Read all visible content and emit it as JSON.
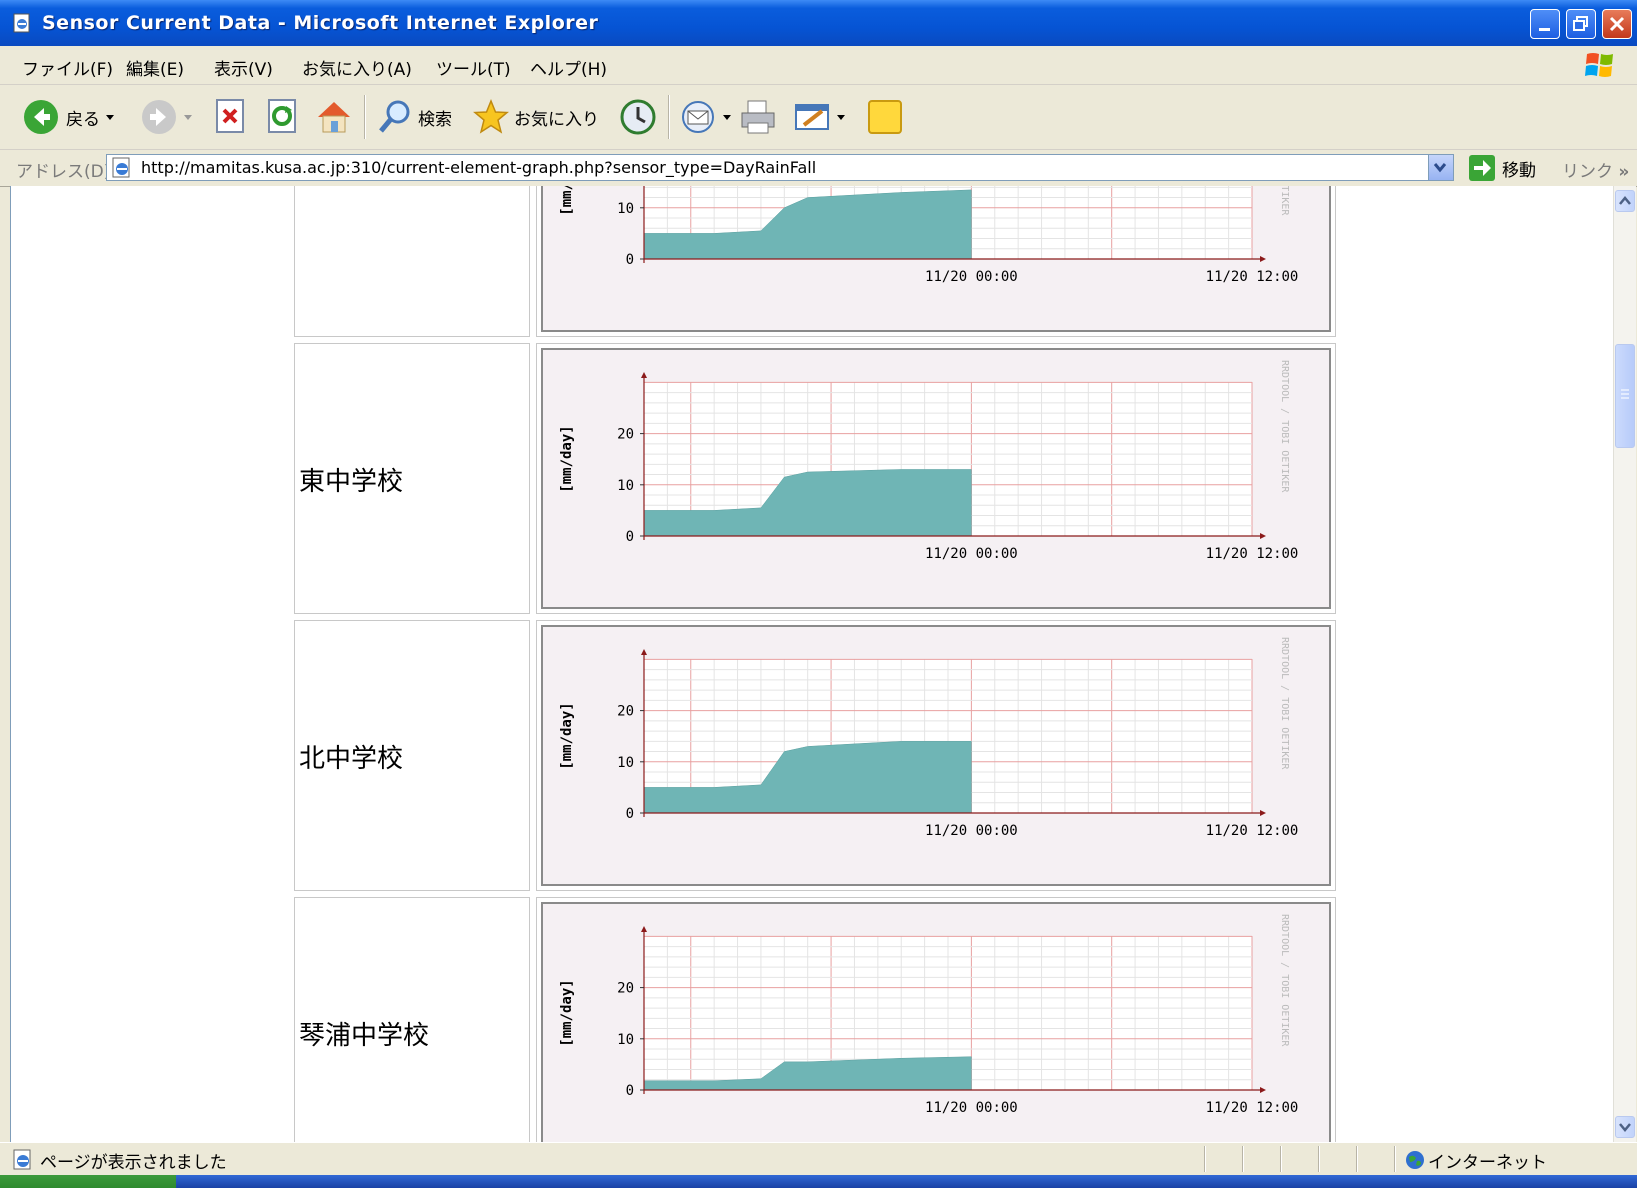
{
  "window": {
    "title": "Sensor Current Data - Microsoft Internet Explorer"
  },
  "menu": {
    "items": [
      "ファイル(F)",
      "編集(E)",
      "表示(V)",
      "お気に入り(A)",
      "ツール(T)",
      "ヘルプ(H)"
    ]
  },
  "toolbar": {
    "back_label": "戻る",
    "search_label": "検索",
    "favorites_label": "お気に入り"
  },
  "address": {
    "label": "アドレス(D)",
    "url": "http://mamitas.kusa.ac.jp:310/current-element-graph.php?sensor_type=DayRainFall",
    "go_label": "移動",
    "links_label": "リンク"
  },
  "graph_common": {
    "y_label": "[mm/day]",
    "y_ticks": [
      "0",
      "10",
      "20"
    ],
    "x_ticks": [
      "11/20 00:00",
      "11/20 12:00"
    ],
    "watermark": "RRDTOOL / TOBI OETIKER",
    "fill_color": "#6fb5b5",
    "grid_major_color": "#e8a0a0",
    "axis_color": "#8b1a1a"
  },
  "chart_data": [
    {
      "type": "area",
      "station": "",
      "ylabel": "[mm/day]",
      "ylim": [
        0,
        30
      ],
      "x": [
        "11/19 10:00",
        "11/19 13:00",
        "11/19 15:00",
        "11/19 16:00",
        "11/19 17:00",
        "11/19 21:00",
        "11/20 00:00"
      ],
      "values": [
        5,
        5,
        5.5,
        10,
        12,
        13,
        13.5
      ]
    },
    {
      "type": "area",
      "station": "東中学校",
      "ylabel": "[mm/day]",
      "ylim": [
        0,
        30
      ],
      "x": [
        "11/19 10:00",
        "11/19 13:00",
        "11/19 15:00",
        "11/19 16:00",
        "11/19 17:00",
        "11/19 21:00",
        "11/20 00:00"
      ],
      "values": [
        5,
        5,
        5.5,
        11.5,
        12.5,
        13,
        13
      ]
    },
    {
      "type": "area",
      "station": "北中学校",
      "ylabel": "[mm/day]",
      "ylim": [
        0,
        30
      ],
      "x": [
        "11/19 10:00",
        "11/19 13:00",
        "11/19 15:00",
        "11/19 16:00",
        "11/19 17:00",
        "11/19 21:00",
        "11/20 00:00"
      ],
      "values": [
        5,
        5,
        5.5,
        12,
        13,
        14,
        14
      ]
    },
    {
      "type": "area",
      "station": "琴浦中学校",
      "ylabel": "[mm/day]",
      "ylim": [
        0,
        30
      ],
      "x": [
        "11/19 10:00",
        "11/19 13:00",
        "11/19 15:00",
        "11/19 16:00",
        "11/19 17:00",
        "11/19 21:00",
        "11/20 00:00"
      ],
      "values": [
        1.8,
        1.8,
        2.2,
        5.5,
        5.5,
        6.2,
        6.5
      ]
    }
  ],
  "status": {
    "message": "ページが表示されました",
    "zone": "インターネット"
  }
}
